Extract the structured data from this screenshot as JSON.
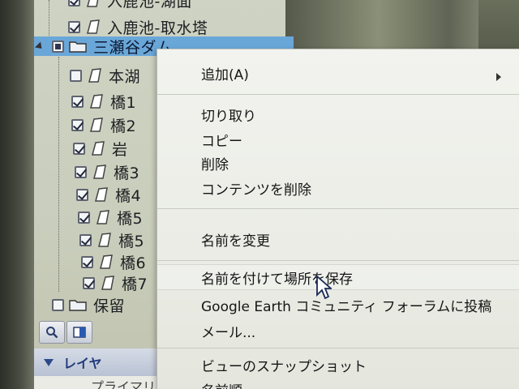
{
  "places": {
    "rows": [
      {
        "label": "入鹿池-湖面",
        "check": "checked"
      },
      {
        "label": "入鹿池-取水塔",
        "check": "checked"
      },
      {
        "label": "三瀬谷ダム",
        "check": "partial"
      },
      {
        "label": "本湖",
        "check": "unchecked"
      },
      {
        "label": "橋1",
        "check": "checked"
      },
      {
        "label": "橋2",
        "check": "checked"
      },
      {
        "label": "岩",
        "check": "checked"
      },
      {
        "label": "橋3",
        "check": "checked"
      },
      {
        "label": "橋4",
        "check": "checked"
      },
      {
        "label": "橋5",
        "check": "checked"
      },
      {
        "label": "橋5",
        "check": "checked"
      },
      {
        "label": "橋6",
        "check": "checked"
      },
      {
        "label": "橋7",
        "check": "checked"
      },
      {
        "label": "保留",
        "check": "unchecked"
      }
    ]
  },
  "layers": {
    "title": "レイヤ",
    "partial_item": "プライマリ"
  },
  "context_menu": {
    "items": {
      "add": "追加(A)",
      "cut": "切り取り",
      "copy": "コピー",
      "delete": "削除",
      "delete_contents": "コンテンツを削除",
      "rename": "名前を変更",
      "save_place_as": "名前を付けて場所を保存",
      "post_to_community": "Google Earth コミュニティ フォーラムに投稿",
      "mail": "メール...",
      "snapshot_view": "ビューのスナップショット",
      "sort_by_name": "名前順"
    }
  },
  "colors": {
    "selection": "#6aa7d9",
    "menu_bg": "#f2f3ee"
  }
}
